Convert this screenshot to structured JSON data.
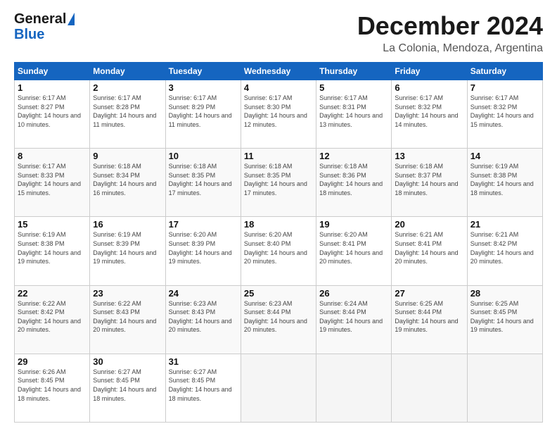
{
  "logo": {
    "line1": "General",
    "line2": "Blue"
  },
  "header": {
    "title": "December 2024",
    "subtitle": "La Colonia, Mendoza, Argentina"
  },
  "days_of_week": [
    "Sunday",
    "Monday",
    "Tuesday",
    "Wednesday",
    "Thursday",
    "Friday",
    "Saturday"
  ],
  "weeks": [
    [
      {
        "day": "1",
        "sunrise": "6:17 AM",
        "sunset": "8:27 PM",
        "daylight": "14 hours and 10 minutes."
      },
      {
        "day": "2",
        "sunrise": "6:17 AM",
        "sunset": "8:28 PM",
        "daylight": "14 hours and 11 minutes."
      },
      {
        "day": "3",
        "sunrise": "6:17 AM",
        "sunset": "8:29 PM",
        "daylight": "14 hours and 11 minutes."
      },
      {
        "day": "4",
        "sunrise": "6:17 AM",
        "sunset": "8:30 PM",
        "daylight": "14 hours and 12 minutes."
      },
      {
        "day": "5",
        "sunrise": "6:17 AM",
        "sunset": "8:31 PM",
        "daylight": "14 hours and 13 minutes."
      },
      {
        "day": "6",
        "sunrise": "6:17 AM",
        "sunset": "8:32 PM",
        "daylight": "14 hours and 14 minutes."
      },
      {
        "day": "7",
        "sunrise": "6:17 AM",
        "sunset": "8:32 PM",
        "daylight": "14 hours and 15 minutes."
      }
    ],
    [
      {
        "day": "8",
        "sunrise": "6:17 AM",
        "sunset": "8:33 PM",
        "daylight": "14 hours and 15 minutes."
      },
      {
        "day": "9",
        "sunrise": "6:18 AM",
        "sunset": "8:34 PM",
        "daylight": "14 hours and 16 minutes."
      },
      {
        "day": "10",
        "sunrise": "6:18 AM",
        "sunset": "8:35 PM",
        "daylight": "14 hours and 17 minutes."
      },
      {
        "day": "11",
        "sunrise": "6:18 AM",
        "sunset": "8:35 PM",
        "daylight": "14 hours and 17 minutes."
      },
      {
        "day": "12",
        "sunrise": "6:18 AM",
        "sunset": "8:36 PM",
        "daylight": "14 hours and 18 minutes."
      },
      {
        "day": "13",
        "sunrise": "6:18 AM",
        "sunset": "8:37 PM",
        "daylight": "14 hours and 18 minutes."
      },
      {
        "day": "14",
        "sunrise": "6:19 AM",
        "sunset": "8:38 PM",
        "daylight": "14 hours and 18 minutes."
      }
    ],
    [
      {
        "day": "15",
        "sunrise": "6:19 AM",
        "sunset": "8:38 PM",
        "daylight": "14 hours and 19 minutes."
      },
      {
        "day": "16",
        "sunrise": "6:19 AM",
        "sunset": "8:39 PM",
        "daylight": "14 hours and 19 minutes."
      },
      {
        "day": "17",
        "sunrise": "6:20 AM",
        "sunset": "8:39 PM",
        "daylight": "14 hours and 19 minutes."
      },
      {
        "day": "18",
        "sunrise": "6:20 AM",
        "sunset": "8:40 PM",
        "daylight": "14 hours and 20 minutes."
      },
      {
        "day": "19",
        "sunrise": "6:20 AM",
        "sunset": "8:41 PM",
        "daylight": "14 hours and 20 minutes."
      },
      {
        "day": "20",
        "sunrise": "6:21 AM",
        "sunset": "8:41 PM",
        "daylight": "14 hours and 20 minutes."
      },
      {
        "day": "21",
        "sunrise": "6:21 AM",
        "sunset": "8:42 PM",
        "daylight": "14 hours and 20 minutes."
      }
    ],
    [
      {
        "day": "22",
        "sunrise": "6:22 AM",
        "sunset": "8:42 PM",
        "daylight": "14 hours and 20 minutes."
      },
      {
        "day": "23",
        "sunrise": "6:22 AM",
        "sunset": "8:43 PM",
        "daylight": "14 hours and 20 minutes."
      },
      {
        "day": "24",
        "sunrise": "6:23 AM",
        "sunset": "8:43 PM",
        "daylight": "14 hours and 20 minutes."
      },
      {
        "day": "25",
        "sunrise": "6:23 AM",
        "sunset": "8:44 PM",
        "daylight": "14 hours and 20 minutes."
      },
      {
        "day": "26",
        "sunrise": "6:24 AM",
        "sunset": "8:44 PM",
        "daylight": "14 hours and 19 minutes."
      },
      {
        "day": "27",
        "sunrise": "6:25 AM",
        "sunset": "8:44 PM",
        "daylight": "14 hours and 19 minutes."
      },
      {
        "day": "28",
        "sunrise": "6:25 AM",
        "sunset": "8:45 PM",
        "daylight": "14 hours and 19 minutes."
      }
    ],
    [
      {
        "day": "29",
        "sunrise": "6:26 AM",
        "sunset": "8:45 PM",
        "daylight": "14 hours and 18 minutes."
      },
      {
        "day": "30",
        "sunrise": "6:27 AM",
        "sunset": "8:45 PM",
        "daylight": "14 hours and 18 minutes."
      },
      {
        "day": "31",
        "sunrise": "6:27 AM",
        "sunset": "8:45 PM",
        "daylight": "14 hours and 18 minutes."
      },
      null,
      null,
      null,
      null
    ]
  ]
}
